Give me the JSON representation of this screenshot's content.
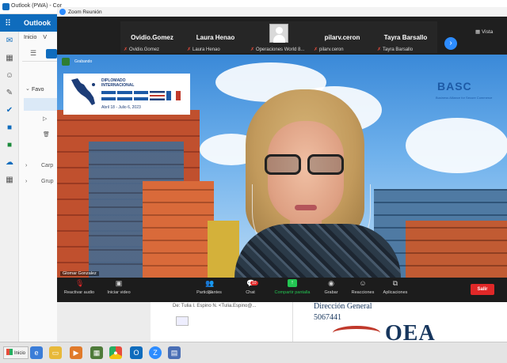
{
  "outlook": {
    "window_title": "Outlook (PWA) - Cor",
    "app_name": "Outlook",
    "tabs": [
      "Inicio",
      "V"
    ],
    "nav_favorites": "Favo",
    "nav_folders": [
      "Carp",
      "Grup"
    ],
    "email_snippet": "De: Tulia I. Espino N. <Tulia.Espino@...",
    "signature_title": "Dirección General",
    "signature_phone": "5067441",
    "signature_logo": "OEA"
  },
  "zoom": {
    "window_title": "Zoom Reunión",
    "view_label": "Vista",
    "participants": [
      {
        "name": "Ovidio.Gomez",
        "sub": "Ovidio.Gomez"
      },
      {
        "name": "Laura Henao",
        "sub": "Laura Henao"
      },
      {
        "name": "",
        "sub": "Operaciones World 8..."
      },
      {
        "name": "pilarv.ceron",
        "sub": "pilarv.ceron"
      },
      {
        "name": "Tayra Barsallo",
        "sub": "Tayra Barsallo"
      }
    ],
    "recording_label": "Grabando",
    "speaker_name": "Glomar Gonzalez",
    "banner": {
      "line1": "DIPLOMADO",
      "line2": "INTERNACIONAL",
      "dates": "Abril 18 - Julio 6, 2023"
    },
    "sponsor_logo": "BASC",
    "sponsor_sub": "Business Alliance for Secure Commerce",
    "toolbar": {
      "audio": "Reactivar audio",
      "video": "Iniciar video",
      "participants": "Participantes",
      "participants_count": "22",
      "chat": "Chat",
      "chat_badge": "10",
      "share": "Compartir pantalla",
      "record": "Grabar",
      "reactions": "Reacciones",
      "apps": "Aplicaciones",
      "leave": "Salir"
    }
  },
  "taskbar": {
    "start_label": "Inicio",
    "apps": [
      "internet-explorer",
      "file-explorer",
      "media-player",
      "app-4",
      "chrome",
      "outlook",
      "zoom",
      "app-8"
    ]
  }
}
